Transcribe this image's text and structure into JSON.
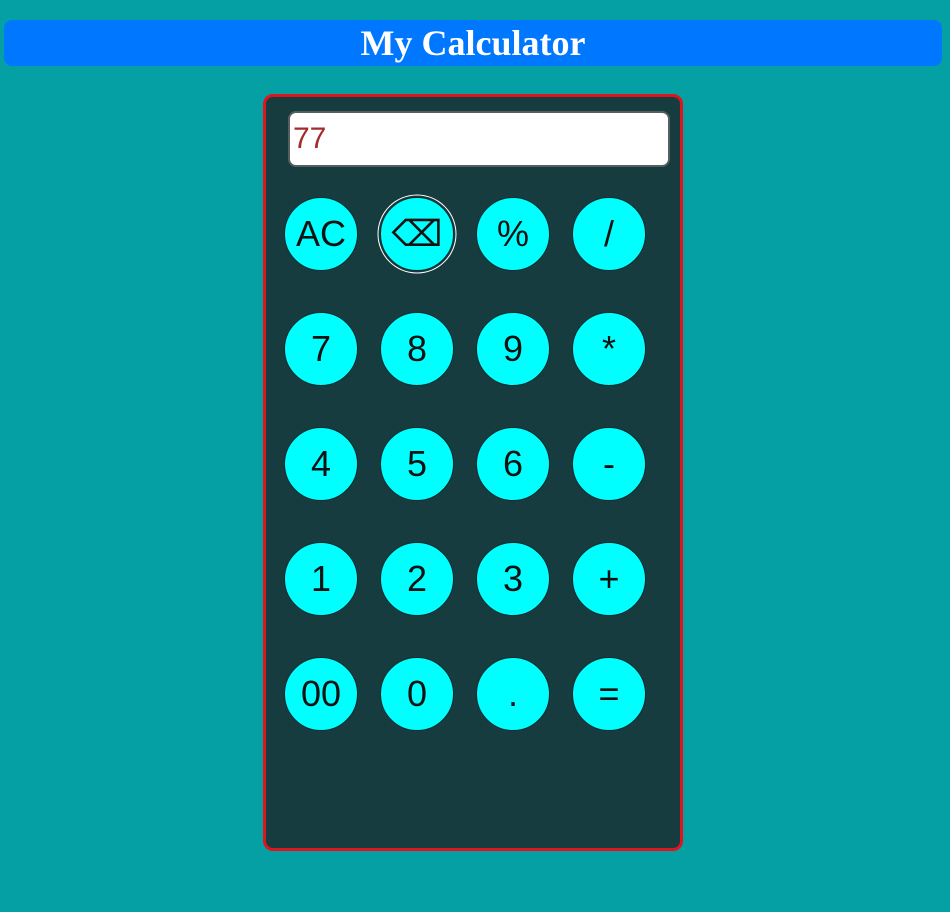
{
  "header": {
    "title": "My Calculator"
  },
  "display": {
    "value": "77"
  },
  "keys": {
    "ac": "AC",
    "backspace": "⌫",
    "percent": "%",
    "divide": "/",
    "seven": "7",
    "eight": "8",
    "nine": "9",
    "multiply": "*",
    "four": "4",
    "five": "5",
    "six": "6",
    "subtract": "-",
    "one": "1",
    "two": "2",
    "three": "3",
    "add": "+",
    "double_zero": "00",
    "zero": "0",
    "decimal": ".",
    "equals": "="
  },
  "colors": {
    "page_background": "#05a0a4",
    "title_bar": "#0077ff",
    "panel_background": "#173c3f",
    "panel_border": "#e0141c",
    "key_fill": "#00ffff",
    "display_text": "#a52a2a"
  }
}
